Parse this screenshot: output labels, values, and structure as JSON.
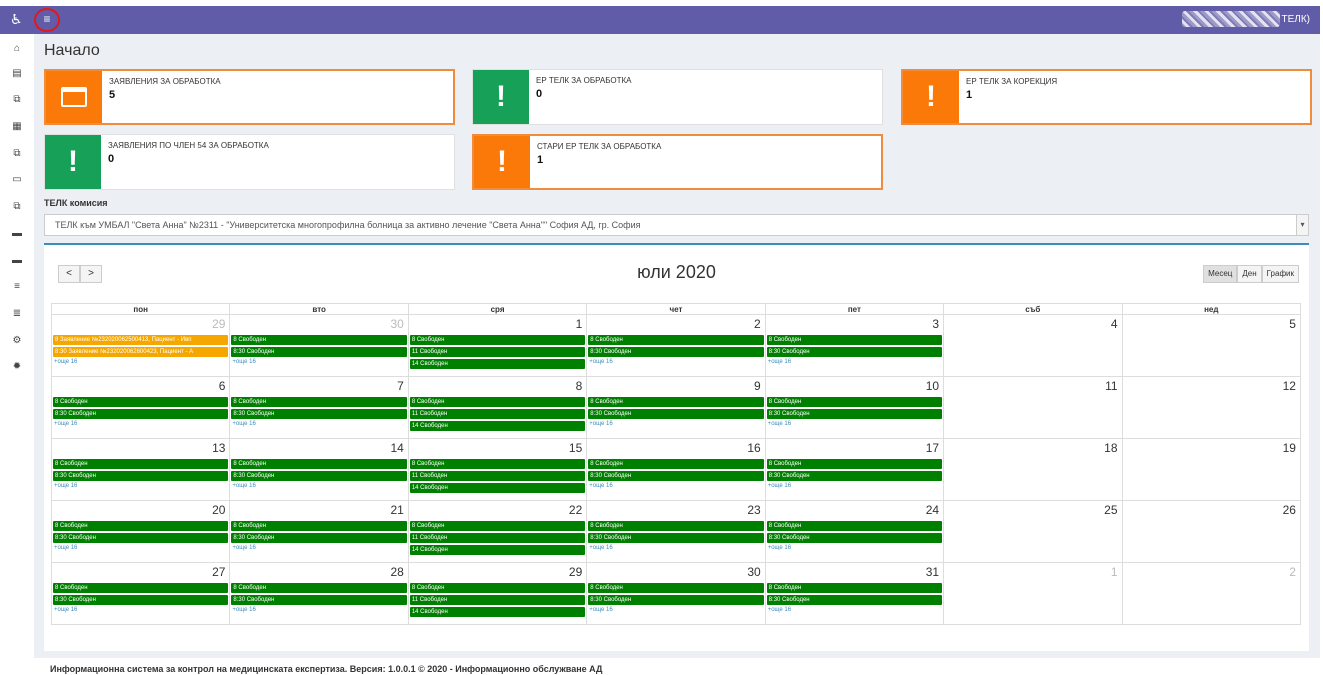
{
  "topbar": {
    "access_icon": "wheelchair-icon",
    "menu_icon": "hamburger-icon",
    "user_suffix": "ТЕЛК)"
  },
  "sidebar": {
    "items": [
      {
        "icon": "home-icon",
        "glyph": "⌂"
      },
      {
        "icon": "document-icon",
        "glyph": "▤"
      },
      {
        "icon": "copy-icon",
        "glyph": "⧉"
      },
      {
        "icon": "calendar-icon",
        "glyph": "▦"
      },
      {
        "icon": "copy-icon-2",
        "glyph": "⧉"
      },
      {
        "icon": "folder-icon",
        "glyph": "▭"
      },
      {
        "icon": "copy-icon-3",
        "glyph": "⧉"
      },
      {
        "icon": "card-icon",
        "glyph": "▬"
      },
      {
        "icon": "card-icon-2",
        "glyph": "▬"
      },
      {
        "icon": "list-icon",
        "glyph": "≡"
      },
      {
        "icon": "database-icon",
        "glyph": "≣"
      },
      {
        "icon": "cogs-icon",
        "glyph": "⚙"
      },
      {
        "icon": "gear-icon",
        "glyph": "✹"
      }
    ]
  },
  "page": {
    "title": "Начало"
  },
  "tiles": [
    {
      "label": "ЗАЯВЛЕНИЯ ЗА ОБРАБОТКА",
      "count": "5",
      "color": "#fb7908",
      "icon": "calendar-icon"
    },
    {
      "label": "ЕР ТЕЛК ЗА ОБРАБОТКА",
      "count": "0",
      "color": "#16a058",
      "icon": "exclamation-icon"
    },
    {
      "label": "ЕР ТЕЛК ЗА КОРЕКЦИЯ",
      "count": "1",
      "color": "#fb7908",
      "icon": "exclamation-icon"
    },
    {
      "label": "ЗАЯВЛЕНИЯ ПО ЧЛЕН 54 ЗА ОБРАБОТКА",
      "count": "0",
      "color": "#16a058",
      "icon": "exclamation-icon"
    },
    {
      "label": "СТАРИ ЕР ТЕЛК ЗА ОБРАБОТКА",
      "count": "1",
      "color": "#fb7908",
      "icon": "exclamation-icon"
    }
  ],
  "commission": {
    "label": "ТЕЛК комисия",
    "value": "ТЕЛК към УМБАЛ \"Света Анна\" №2311 - \"Университетска многопрофилна болница за активно лечение \"Света Анна\"\" София АД, гр. София"
  },
  "calendar": {
    "title": "юли 2020",
    "prev_label": "<",
    "next_label": ">",
    "views": [
      "Месец",
      "Ден",
      "График"
    ],
    "weekdays": [
      "пон",
      "вто",
      "сря",
      "чет",
      "пет",
      "съб",
      "нед"
    ],
    "more_label": "+още 16",
    "free_a": "8 Свободен",
    "free_b": "8:30 Свободен",
    "free_c": "11 Свободен",
    "free_d": "14 Свободен",
    "app1": "8 Заявление №232020062500413, Пациент - Ивп",
    "app2": "8:30 Заявление №232020062600423, Пациент - А",
    "weeks": [
      [
        "29",
        "30",
        "1",
        "2",
        "3",
        "4",
        "5"
      ],
      [
        "6",
        "7",
        "8",
        "9",
        "10",
        "11",
        "12"
      ],
      [
        "13",
        "14",
        "15",
        "16",
        "17",
        "18",
        "19"
      ],
      [
        "20",
        "21",
        "22",
        "23",
        "24",
        "25",
        "26"
      ],
      [
        "27",
        "28",
        "29",
        "30",
        "31",
        "1",
        "2"
      ]
    ]
  },
  "footer": {
    "text": "Информационна система за контрол на медицинската експертиза. Версия: 1.0.0.1 © 2020 - Информационно обслужване АД"
  }
}
